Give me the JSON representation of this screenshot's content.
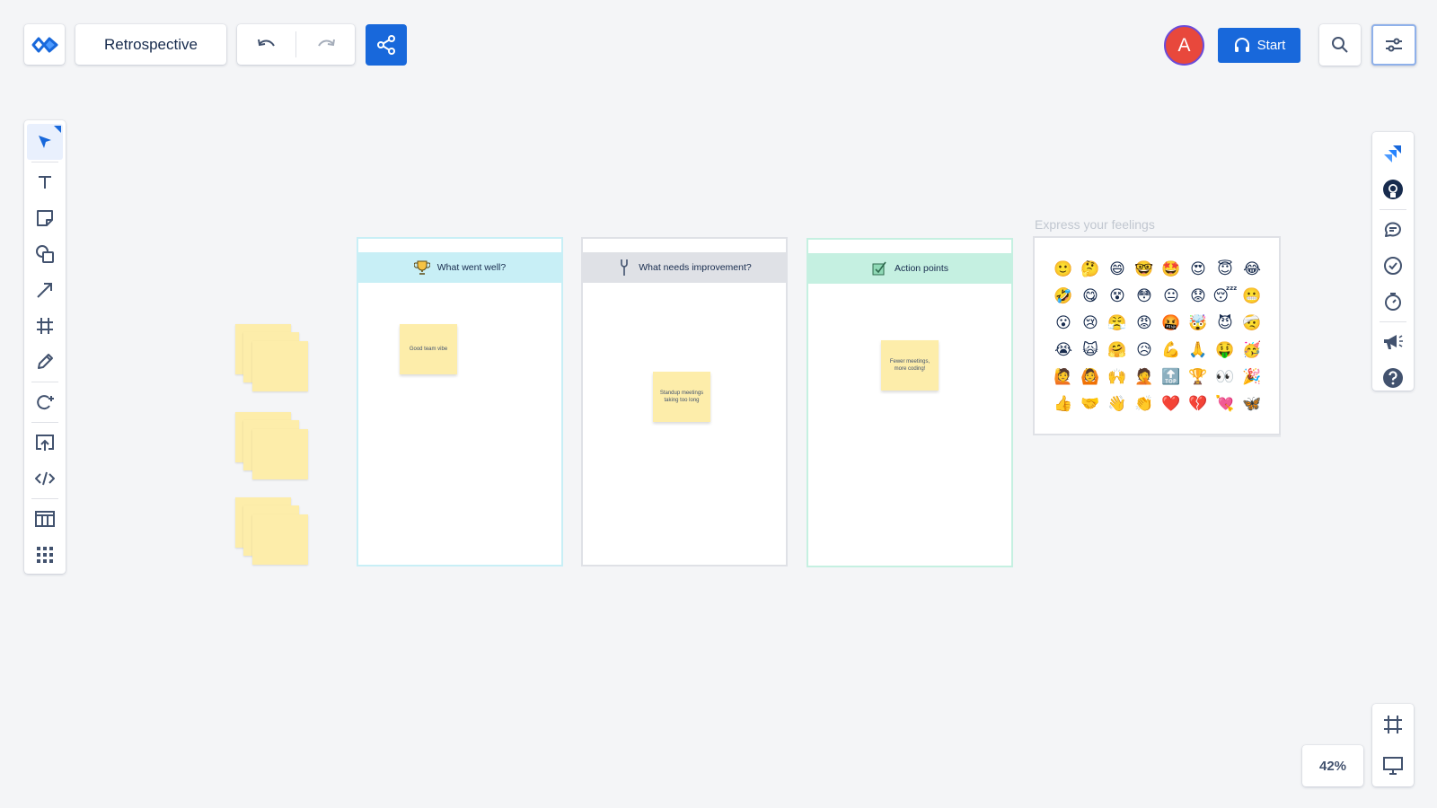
{
  "board": {
    "title": "Retrospective"
  },
  "header": {
    "avatar_initial": "A",
    "start_label": "Start"
  },
  "left_toolbar": {
    "tools": [
      "select-icon",
      "text-icon",
      "sticky-note-icon",
      "shapes-icon",
      "arrow-icon",
      "frame-icon",
      "pen-icon",
      "lasso-icon",
      "upload-icon",
      "embed-code-icon",
      "templates-icon",
      "apps-grid-icon"
    ]
  },
  "right_toolbar": {
    "tools": [
      "jira-icon",
      "github-icon",
      "comments-icon",
      "voting-icon",
      "timer-icon",
      "announce-icon",
      "help-icon"
    ]
  },
  "zoom": {
    "level": "42%"
  },
  "columns": [
    {
      "title": "What went well?",
      "icon": "trophy-icon",
      "header_color": "#c8eff6",
      "border_color": "#c8eff6",
      "notes": [
        "Good team vibe"
      ]
    },
    {
      "title": "What needs improvement?",
      "icon": "wrench-icon",
      "header_color": "#dfe1e6",
      "border_color": "#dfe1e6",
      "notes": [
        "Standup meetings taking too long"
      ]
    },
    {
      "title": "Action points",
      "icon": "checklist-icon",
      "header_color": "#c5f0e1",
      "border_color": "#c5f0e1",
      "notes": [
        "Fewer meetings, more coding!"
      ]
    }
  ],
  "feelings": {
    "title": "Express your feelings",
    "emojis": [
      "🙂",
      "🤔",
      "😄",
      "🤓",
      "🤩",
      "😍",
      "😇",
      "😂",
      "🤣",
      "😋",
      "😵",
      "😳",
      "😐",
      "😟",
      "😴",
      "😬",
      "😮",
      "😢",
      "😤",
      "😡",
      "🤬",
      "🤯",
      "😈",
      "🤕",
      "😭",
      "🙀",
      "🤗",
      "😥",
      "💪",
      "🙏",
      "🤑",
      "🥳",
      "🙋",
      "🙆",
      "🙌",
      "🤦",
      "🔝",
      "🏆",
      "👀",
      "🎉",
      "👍",
      "🤝",
      "👋",
      "👏",
      "❤️",
      "💔",
      "💘",
      "🦋"
    ]
  }
}
